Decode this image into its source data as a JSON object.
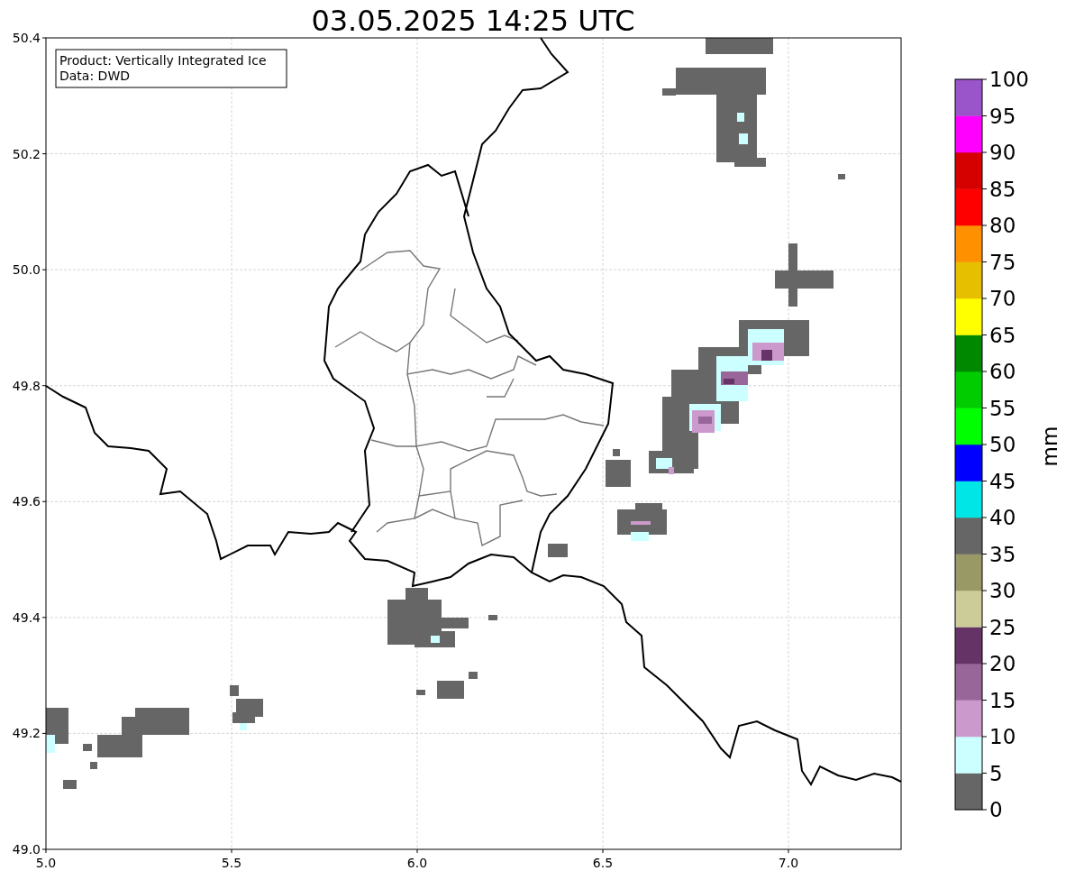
{
  "title": "03.05.2025 14:25 UTC",
  "info_box": {
    "lines": [
      "Product: Vertically Integrated Ice",
      "Data: DWD"
    ]
  },
  "map": {
    "x_ticks": [
      "5.0",
      "5.5",
      "6.0",
      "6.5",
      "7.0"
    ],
    "y_ticks": [
      "50.4",
      "50.2",
      "50.0",
      "49.8",
      "49.6",
      "49.4",
      "49.2",
      "49.0"
    ]
  },
  "colorbar": {
    "label": "mm",
    "ticks": [
      "100",
      "95",
      "90",
      "85",
      "80",
      "75",
      "70",
      "65",
      "60",
      "55",
      "50",
      "45",
      "40",
      "35",
      "30",
      "25",
      "20",
      "15",
      "10",
      "5",
      "0"
    ],
    "bins": [
      {
        "color": "#666666"
      },
      {
        "color": "#ccffff"
      },
      {
        "color": "#cc99cc"
      },
      {
        "color": "#996699"
      },
      {
        "color": "#663366"
      },
      {
        "color": "#cccc99"
      },
      {
        "color": "#999966"
      },
      {
        "color": "#666666"
      },
      {
        "color": "#00e5e5"
      },
      {
        "color": "#0000ff"
      },
      {
        "color": "#00ff00"
      },
      {
        "color": "#00cc00"
      },
      {
        "color": "#008800"
      },
      {
        "color": "#ffff00"
      },
      {
        "color": "#e5bf00"
      },
      {
        "color": "#ff9000"
      },
      {
        "color": "#ff0000"
      },
      {
        "color": "#d50000"
      },
      {
        "color": "#ff00ff"
      },
      {
        "color": "#9955c9"
      }
    ]
  }
}
